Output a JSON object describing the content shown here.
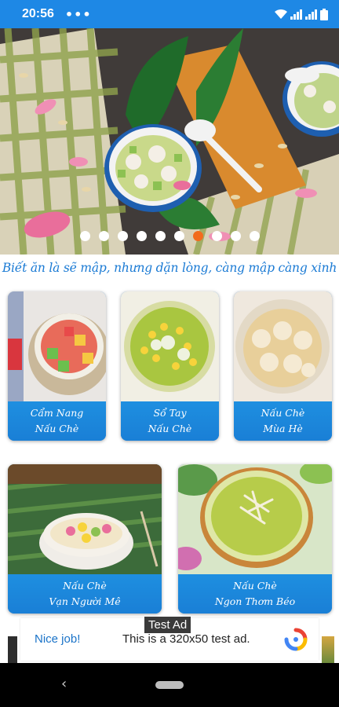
{
  "status_bar": {
    "time": "20:56",
    "more": "•••",
    "icons": [
      "wifi-icon",
      "signal-icon",
      "signal-icon",
      "battery-icon"
    ]
  },
  "banner": {
    "slide_count": 10,
    "active_index": 6
  },
  "tagline": "Biết ăn là sẽ mập, nhưng dặn lòng, càng mập càng xinh",
  "cards": [
    {
      "line1": "Cẩm Nang",
      "line2": "Nấu Chè"
    },
    {
      "line1": "Sổ Tay",
      "line2": "Nấu Chè"
    },
    {
      "line1": "Nấu Chè",
      "line2": "Mùa Hè"
    },
    {
      "line1": "Nấu Chè",
      "line2": "Vạn Người Mê"
    },
    {
      "line1": "Nấu Chè",
      "line2": "Ngon Thơm Béo"
    }
  ],
  "ad": {
    "badge": "Test Ad",
    "nice": "Nice job!",
    "text": "This is a 320x50 test ad."
  },
  "nav": {
    "back": "‹"
  },
  "colors": {
    "primary": "#1e88e5",
    "tagline": "#1a7ad4",
    "active_dot": "#f26b1d"
  }
}
